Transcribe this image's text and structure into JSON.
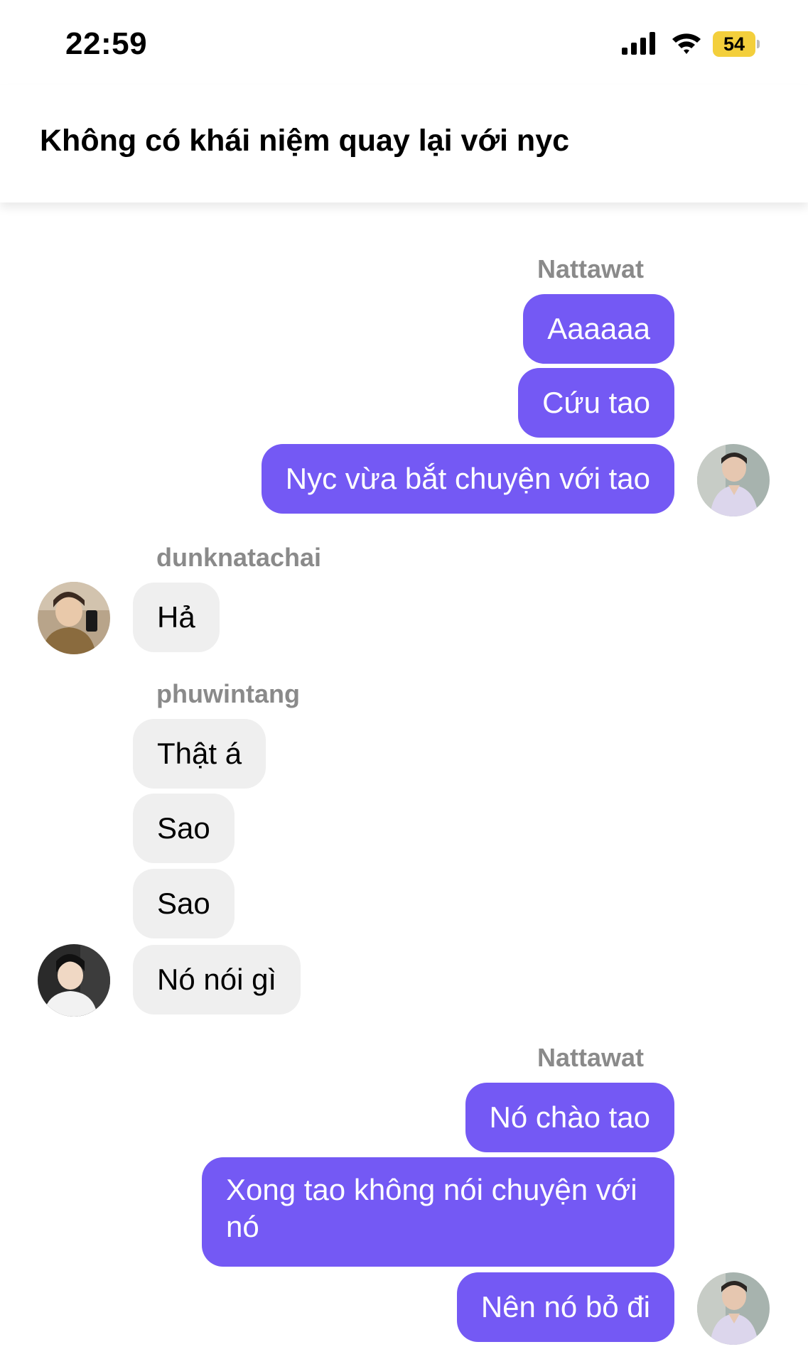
{
  "status_bar": {
    "time": "22:59",
    "battery": "54"
  },
  "header": {
    "title": "Không có khái niệm quay lại với nyc"
  },
  "messages": {
    "group1": {
      "sender": "Nattawat",
      "lines": [
        "Aaaaaa",
        "Cứu tao",
        "Nyc vừa bắt chuyện với tao"
      ]
    },
    "group2": {
      "sender": "dunknatachai",
      "lines": [
        "Hả"
      ]
    },
    "group3": {
      "sender": "phuwintang",
      "lines": [
        "Thật á",
        "Sao",
        "Sao",
        "Nó nói gì"
      ]
    },
    "group4": {
      "sender": "Nattawat",
      "lines": [
        "Nó chào tao",
        "Xong tao không nói chuyện với nó",
        "Nên nó bỏ đi"
      ]
    }
  },
  "colors": {
    "outgoing_bubble": "#7459f4",
    "incoming_bubble": "#efefef",
    "battery": "#f3cf3c"
  }
}
